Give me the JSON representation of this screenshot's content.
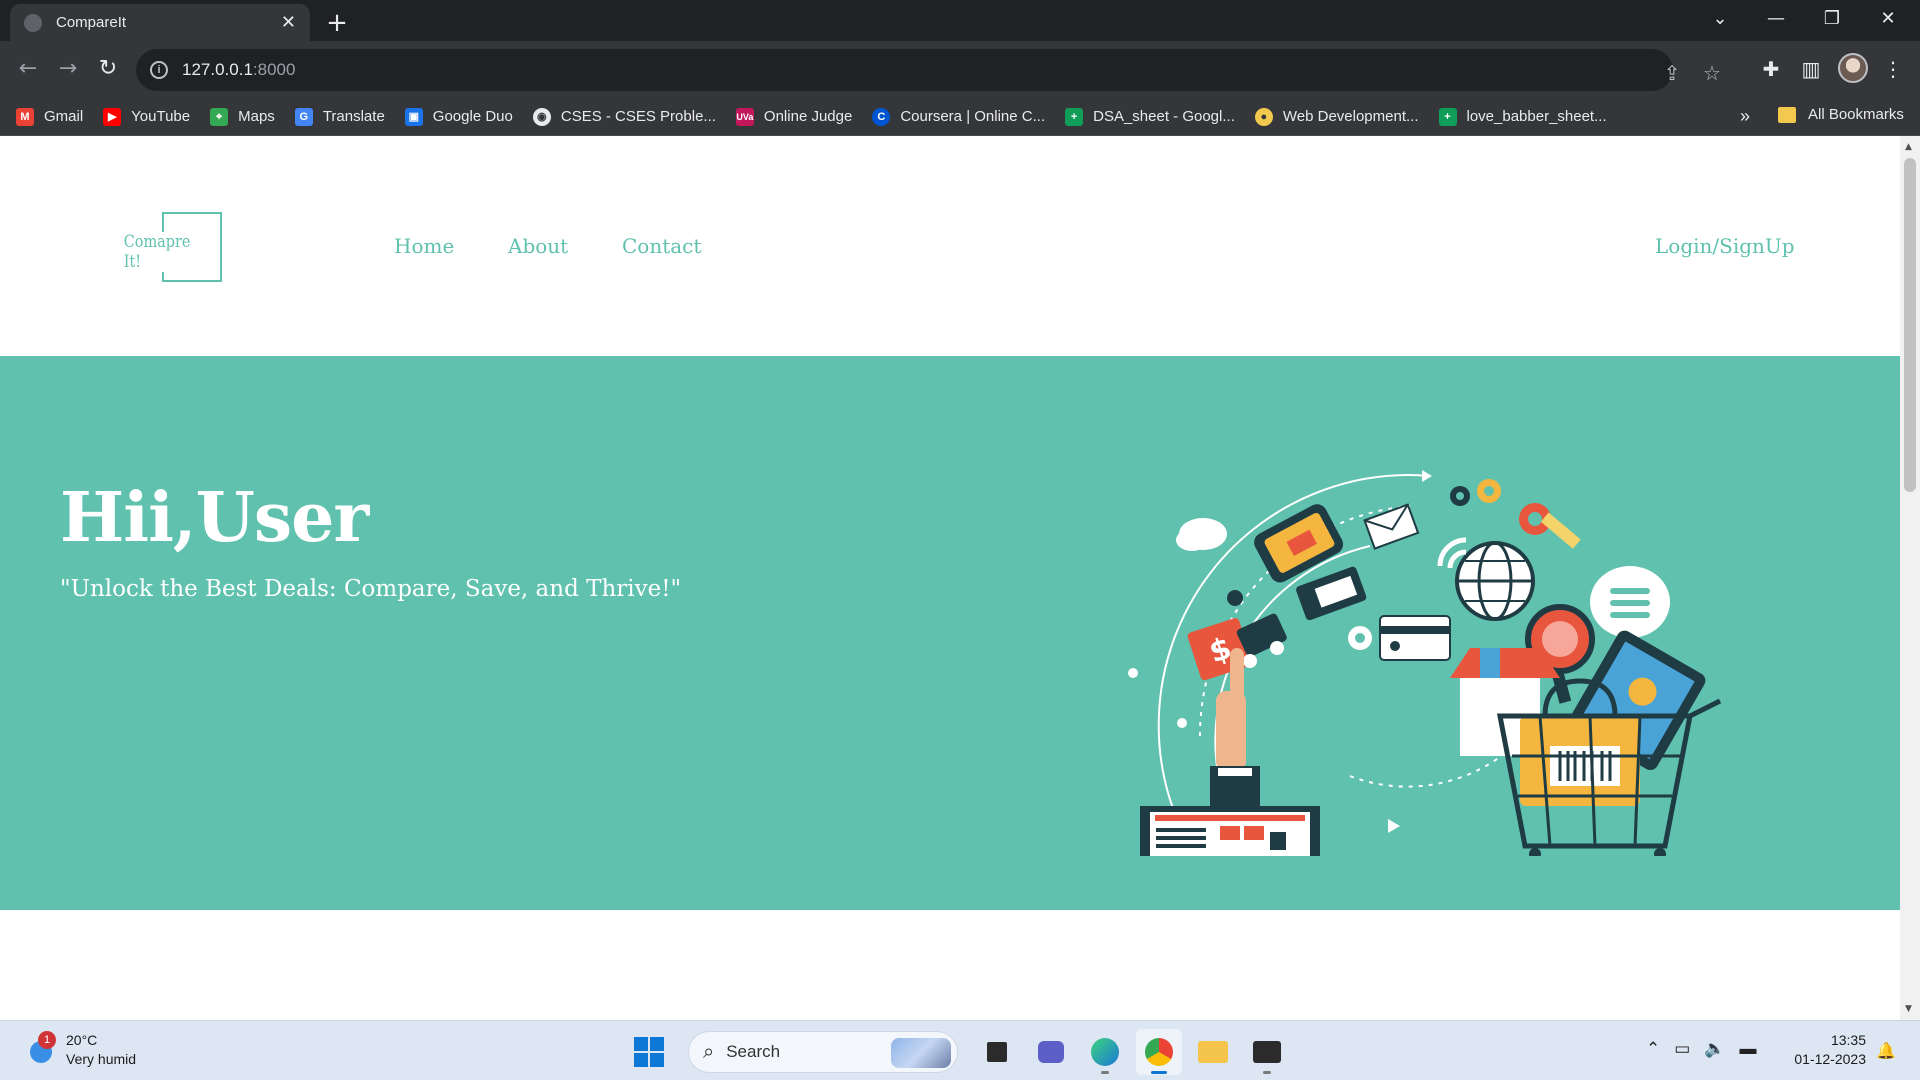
{
  "browser": {
    "tab_title": "CompareIt",
    "url_host": "127.0.0.1",
    "url_port": ":8000",
    "bookmarks": [
      {
        "label": "Gmail",
        "color": "#ea4335",
        "glyph": "M"
      },
      {
        "label": "YouTube",
        "color": "#ff0000",
        "glyph": "▶"
      },
      {
        "label": "Maps",
        "color": "#34a853",
        "glyph": "⌖"
      },
      {
        "label": "Translate",
        "color": "#4285f4",
        "glyph": "G"
      },
      {
        "label": "Google Duo",
        "color": "#1a73e8",
        "glyph": "▣"
      },
      {
        "label": "CSES - CSES Proble...",
        "color": "#5f6368",
        "glyph": "◉"
      },
      {
        "label": "Online Judge",
        "color": "#c2185b",
        "glyph": "UVa"
      },
      {
        "label": "Coursera | Online C...",
        "color": "#0056d2",
        "glyph": "C"
      },
      {
        "label": "DSA_sheet - Googl...",
        "color": "#0f9d58",
        "glyph": "+"
      },
      {
        "label": "Web Development...",
        "color": "#e8eaed",
        "glyph": "●"
      },
      {
        "label": "love_babber_sheet...",
        "color": "#0f9d58",
        "glyph": "+"
      }
    ],
    "all_bookmarks": "All Bookmarks"
  },
  "site": {
    "logo_text": "Comapre It!",
    "nav": [
      "Home",
      "About",
      "Contact"
    ],
    "login": "Login/SignUp",
    "hero_title": "Hii,User",
    "hero_tagline": "\"Unlock the Best Deals: Compare, Save, and Thrive!\"",
    "brand_color": "#5fc1ae"
  },
  "taskbar": {
    "temperature": "20°C",
    "weather": "Very humid",
    "weather_badge": "1",
    "search_placeholder": "Search",
    "time": "13:35",
    "date": "01-12-2023"
  }
}
